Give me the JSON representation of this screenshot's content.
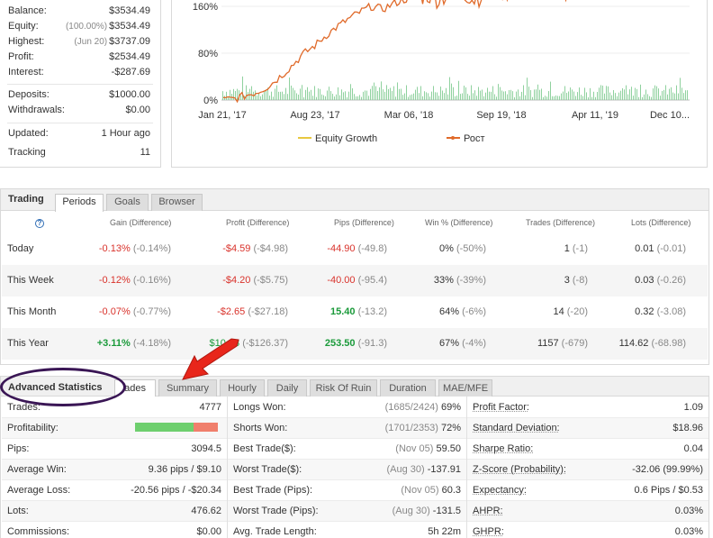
{
  "account": {
    "balance": {
      "label": "Balance:",
      "value": "$3534.49"
    },
    "equity": {
      "label": "Equity:",
      "note": "(100.00%)",
      "value": "$3534.49"
    },
    "highest": {
      "label": "Highest:",
      "note": "(Jun 20)",
      "value": "$3737.09"
    },
    "profit": {
      "label": "Profit:",
      "value": "$2534.49"
    },
    "interest": {
      "label": "Interest:",
      "value": "-$287.69"
    },
    "deposits": {
      "label": "Deposits:",
      "value": "$1000.00"
    },
    "withdrawals": {
      "label": "Withdrawals:",
      "value": "$0.00"
    },
    "updated": {
      "label": "Updated:",
      "value": "1 Hour ago"
    },
    "tracking": {
      "label": "Tracking",
      "value": "11"
    }
  },
  "chart_data": {
    "type": "line",
    "x_ticks": [
      "Jan 21, '17",
      "Aug 23, '17",
      "Mar 06, '18",
      "Sep 19, '18",
      "Apr 11, '19",
      "Dec 10..."
    ],
    "y_ticks": [
      "0%",
      "80%",
      "160%"
    ],
    "series": [
      {
        "name": "Equity Growth",
        "color": "#e8c840",
        "values": [
          0,
          2,
          8,
          14,
          24,
          40,
          58,
          78,
          92,
          110,
          125,
          138,
          150,
          160,
          155,
          165,
          172,
          178,
          182,
          175,
          185,
          190,
          172,
          186,
          191,
          188,
          192,
          194,
          190,
          187,
          189,
          193,
          196,
          198
        ]
      },
      {
        "name": "Рост",
        "color": "#e06a2a",
        "values": [
          0,
          2,
          8,
          14,
          24,
          40,
          58,
          78,
          92,
          110,
          125,
          138,
          150,
          160,
          155,
          165,
          172,
          178,
          182,
          175,
          185,
          190,
          172,
          186,
          191,
          188,
          192,
          194,
          190,
          187,
          189,
          193,
          196,
          198
        ]
      }
    ],
    "bars": {
      "name": "volume",
      "color": "#8fd19e"
    }
  },
  "trading": {
    "title": "Trading",
    "tabs": [
      "Periods",
      "Goals",
      "Browser"
    ],
    "help_icon": "?",
    "headers": [
      "Gain (Difference)",
      "Profit (Difference)",
      "Pips (Difference)",
      "Win % (Difference)",
      "Trades (Difference)",
      "Lots (Difference)"
    ],
    "rows": [
      {
        "label": "Today",
        "gain": "-0.13%",
        "gain_d": "(-0.14%)",
        "profit": "-$4.59",
        "profit_d": "(-$4.98)",
        "pips": "-44.90",
        "pips_d": "(-49.8)",
        "win": "0%",
        "win_d": "(-50%)",
        "trades": "1",
        "trades_d": "(-1)",
        "lots": "0.01",
        "lots_d": "(-0.01)"
      },
      {
        "label": "This Week",
        "gain": "-0.12%",
        "gain_d": "(-0.16%)",
        "profit": "-$4.20",
        "profit_d": "(-$5.75)",
        "pips": "-40.00",
        "pips_d": "(-95.4)",
        "win": "33%",
        "win_d": "(-39%)",
        "trades": "3",
        "trades_d": "(-8)",
        "lots": "0.03",
        "lots_d": "(-0.26)"
      },
      {
        "label": "This Month",
        "gain": "-0.07%",
        "gain_d": "(-0.77%)",
        "profit": "-$2.65",
        "profit_d": "(-$27.18)",
        "pips": "15.40",
        "pips_d": "(-13.2)",
        "win": "64%",
        "win_d": "(-6%)",
        "trades": "14",
        "trades_d": "(-20)",
        "lots": "0.32",
        "lots_d": "(-3.08)"
      },
      {
        "label": "This Year",
        "gain": "+3.11%",
        "gain_d": "(-4.18%)",
        "profit": "$10_.8",
        "profit_d": "(-$126.37)",
        "pips": "253.50",
        "pips_d": "(-91.3)",
        "win": "67%",
        "win_d": "(-4%)",
        "trades": "1157",
        "trades_d": "(-679)",
        "lots": "114.62",
        "lots_d": "(-68.98)"
      }
    ]
  },
  "advanced": {
    "title": "Advanced Statistics",
    "tabs": [
      "Trades",
      "Summary",
      "Hourly",
      "Daily",
      "Risk Of Ruin",
      "Duration",
      "MAE/MFE"
    ],
    "trades_tab_partial": "ades",
    "col1": [
      {
        "label": "Trades:",
        "value": "4777"
      },
      {
        "label": "Profitability:",
        "value": "",
        "profitability_pct": 70
      },
      {
        "label": "Pips:",
        "value": "3094.5"
      },
      {
        "label": "Average Win:",
        "value": "9.36 pips / $9.10"
      },
      {
        "label": "Average Loss:",
        "value": "-20.56 pips / -$20.34"
      },
      {
        "label": "Lots:",
        "value": "476.62"
      },
      {
        "label": "Commissions:",
        "value": "$0.00"
      }
    ],
    "col2": [
      {
        "label": "Longs Won:",
        "note": "(1685/2424)",
        "value": "69%"
      },
      {
        "label": "Shorts Won:",
        "note": "(1701/2353)",
        "value": "72%"
      },
      {
        "label": "Best Trade($):",
        "note": "(Nov 05)",
        "value": "59.50"
      },
      {
        "label": "Worst Trade($):",
        "note": "(Aug 30)",
        "value": "-137.91"
      },
      {
        "label": "Best Trade (Pips):",
        "note": "(Nov 05)",
        "value": "60.3"
      },
      {
        "label": "Worst Trade (Pips):",
        "note": "(Aug 30)",
        "value": "-131.5"
      },
      {
        "label": "Avg. Trade Length:",
        "note": "",
        "value": "5h 22m"
      }
    ],
    "col3": [
      {
        "label": "Profit Factor:",
        "value": "1.09"
      },
      {
        "label": "Standard Deviation:",
        "value": "$18.96"
      },
      {
        "label": "Sharpe Ratio:",
        "value": "0.04"
      },
      {
        "label": "Z-Score (Probability):",
        "value": "-32.06 (99.99%)"
      },
      {
        "label": "Expectancy:",
        "value": "0.6 Pips / $0.53"
      },
      {
        "label": "AHPR:",
        "value": "0.03%"
      },
      {
        "label": "GHPR:",
        "value": "0.03%"
      }
    ]
  },
  "colors": {
    "accent_red": "#d9322b",
    "accent_green": "#1a9a3a",
    "annotation_arrow": "#e8261b",
    "annotation_ellipse": "#3a1655"
  }
}
